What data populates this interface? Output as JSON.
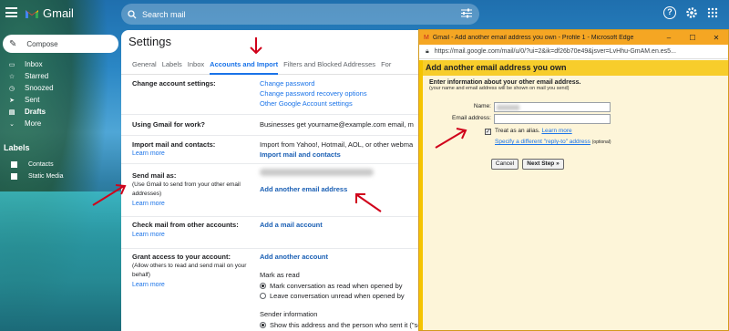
{
  "app": {
    "name": "Gmail"
  },
  "search": {
    "placeholder": "Search mail"
  },
  "icons": {
    "menu": "hamburger-icon",
    "search": "search-icon",
    "filter": "tune-icon",
    "help": "help-icon",
    "settings": "gear-icon",
    "apps": "apps-grid-icon"
  },
  "sidebar": {
    "compose": "Compose",
    "items": [
      {
        "label": "Inbox",
        "icon": "inbox-icon",
        "bold": false
      },
      {
        "label": "Starred",
        "icon": "star-icon",
        "bold": false
      },
      {
        "label": "Snoozed",
        "icon": "clock-icon",
        "bold": false
      },
      {
        "label": "Sent",
        "icon": "send-icon",
        "bold": false
      },
      {
        "label": "Drafts",
        "icon": "file-icon",
        "bold": true
      },
      {
        "label": "More",
        "icon": "chevron-down-icon",
        "bold": false
      }
    ],
    "labels_heading": "Labels",
    "labels": [
      "Contacts",
      "Static Media"
    ]
  },
  "settings": {
    "title": "Settings",
    "tabs": [
      "General",
      "Labels",
      "Inbox",
      "Accounts and Import",
      "Filters and Blocked Addresses",
      "For"
    ],
    "active_tab": "Accounts and Import",
    "change_account": {
      "label": "Change account settings:",
      "links": [
        "Change password",
        "Change password recovery options",
        "Other Google Account settings"
      ]
    },
    "work": {
      "label": "Using Gmail for work?",
      "value": "Businesses get yourname@example.com email, m"
    },
    "import": {
      "label": "Import mail and contacts:",
      "learn": "Learn more",
      "value": "Import from Yahoo!, Hotmail, AOL, or other webma"
    },
    "import_link": "Import mail and contacts",
    "send_as": {
      "label": "Send mail as:",
      "sub": "(Use Gmail to send from your other email addresses)",
      "learn": "Learn more",
      "add": "Add another email address"
    },
    "check_mail": {
      "label": "Check mail from other accounts:",
      "learn": "Learn more",
      "add": "Add a mail account"
    },
    "grant": {
      "label": "Grant access to your account:",
      "sub": "(Allow others to read and send mail on your behalf)",
      "learn": "Learn more",
      "add": "Add another account"
    },
    "mark_as_read": {
      "title": "Mark as read",
      "opt1": "Mark conversation as read when opened by",
      "opt2": "Leave conversation unread when opened by"
    },
    "sender_info": {
      "title": "Sender information",
      "opt1": "Show this address and the person who sent it (\"sent by ...\")"
    }
  },
  "popup": {
    "window_title": "Gmail - Add another email address you own - Profile 1 - Microsoft Edge",
    "window_buttons": [
      "–",
      "☐",
      "✕"
    ],
    "url": "https://mail.google.com/mail/u/0/?ui=2&ik=df26b70e49&jsver=LvHhu-GmAM.en.es5...",
    "heading": "Add another email address you own",
    "info_heading": "Enter information about your other email address.",
    "info_sub": "(your name and email address will be shown on mail you send)",
    "name_label": "Name:",
    "email_label": "Email address:",
    "alias_label": "Treat as an alias.",
    "alias_learn": "Learn more",
    "reply_to": "Specify a different \"reply-to\" address",
    "optional": "(optional)",
    "cancel": "Cancel",
    "next": "Next Step »"
  },
  "colors": {
    "accent": "#1a73e8",
    "popup_header": "#f7cd2b",
    "titlebar": "#f5a623",
    "annotation_arrow": "#d0021b"
  }
}
